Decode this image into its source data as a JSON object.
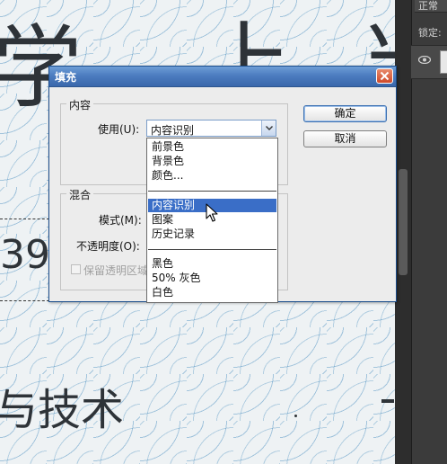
{
  "background": {
    "char_1": "学",
    "char_2": "上",
    "char_3": "当",
    "number": "39",
    "bottom_text": "与技术"
  },
  "side_panel": {
    "blend_mode": "正常",
    "lock_label": "锁定:"
  },
  "dialog": {
    "title": "填充",
    "content_group": {
      "label": "内容",
      "use_label": "使用(U):",
      "use_value": "内容识别"
    },
    "blend_group": {
      "label": "混合",
      "mode_label": "模式(M):",
      "opacity_label": "不透明度(O):",
      "preserve_label": "保留透明区域"
    },
    "ok_label": "确定",
    "cancel_label": "取消"
  },
  "dropdown": {
    "items": [
      {
        "label": "前景色"
      },
      {
        "label": "背景色"
      },
      {
        "label": "颜色..."
      },
      {
        "label": "内容识别",
        "selected": true
      },
      {
        "label": "图案"
      },
      {
        "label": "历史记录"
      },
      {
        "label": "黑色"
      },
      {
        "label": "50% 灰色"
      },
      {
        "label": "白色"
      }
    ]
  },
  "colors": {
    "titlebar": "#4c7cc0",
    "selection": "#3a6ec7",
    "close_button": "#cf4a2a"
  }
}
